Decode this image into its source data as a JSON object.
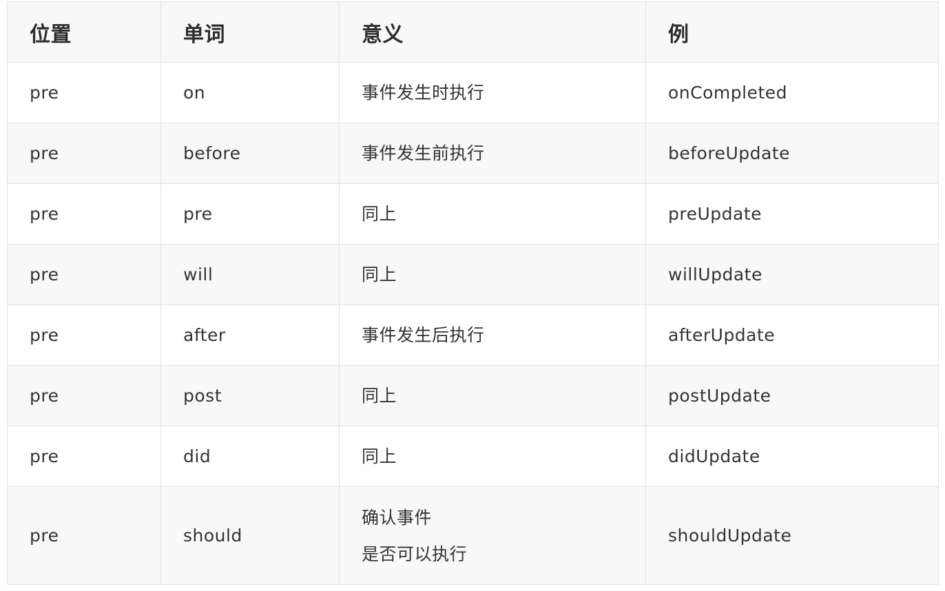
{
  "table": {
    "headers": [
      "位置",
      "单词",
      "意义",
      "例"
    ],
    "rows": [
      {
        "position": "pre",
        "word": "on",
        "meaning": [
          "事件发生时执行"
        ],
        "example": "onCompleted"
      },
      {
        "position": "pre",
        "word": "before",
        "meaning": [
          "事件发生前执行"
        ],
        "example": "beforeUpdate"
      },
      {
        "position": "pre",
        "word": "pre",
        "meaning": [
          "同上"
        ],
        "example": "preUpdate"
      },
      {
        "position": "pre",
        "word": "will",
        "meaning": [
          "同上"
        ],
        "example": "willUpdate"
      },
      {
        "position": "pre",
        "word": "after",
        "meaning": [
          "事件发生后执行"
        ],
        "example": "afterUpdate"
      },
      {
        "position": "pre",
        "word": "post",
        "meaning": [
          "同上"
        ],
        "example": "postUpdate"
      },
      {
        "position": "pre",
        "word": "did",
        "meaning": [
          "同上"
        ],
        "example": "didUpdate"
      },
      {
        "position": "pre",
        "word": "should",
        "meaning": [
          "确认事件",
          "是否可以执行"
        ],
        "example": "shouldUpdate"
      }
    ]
  }
}
